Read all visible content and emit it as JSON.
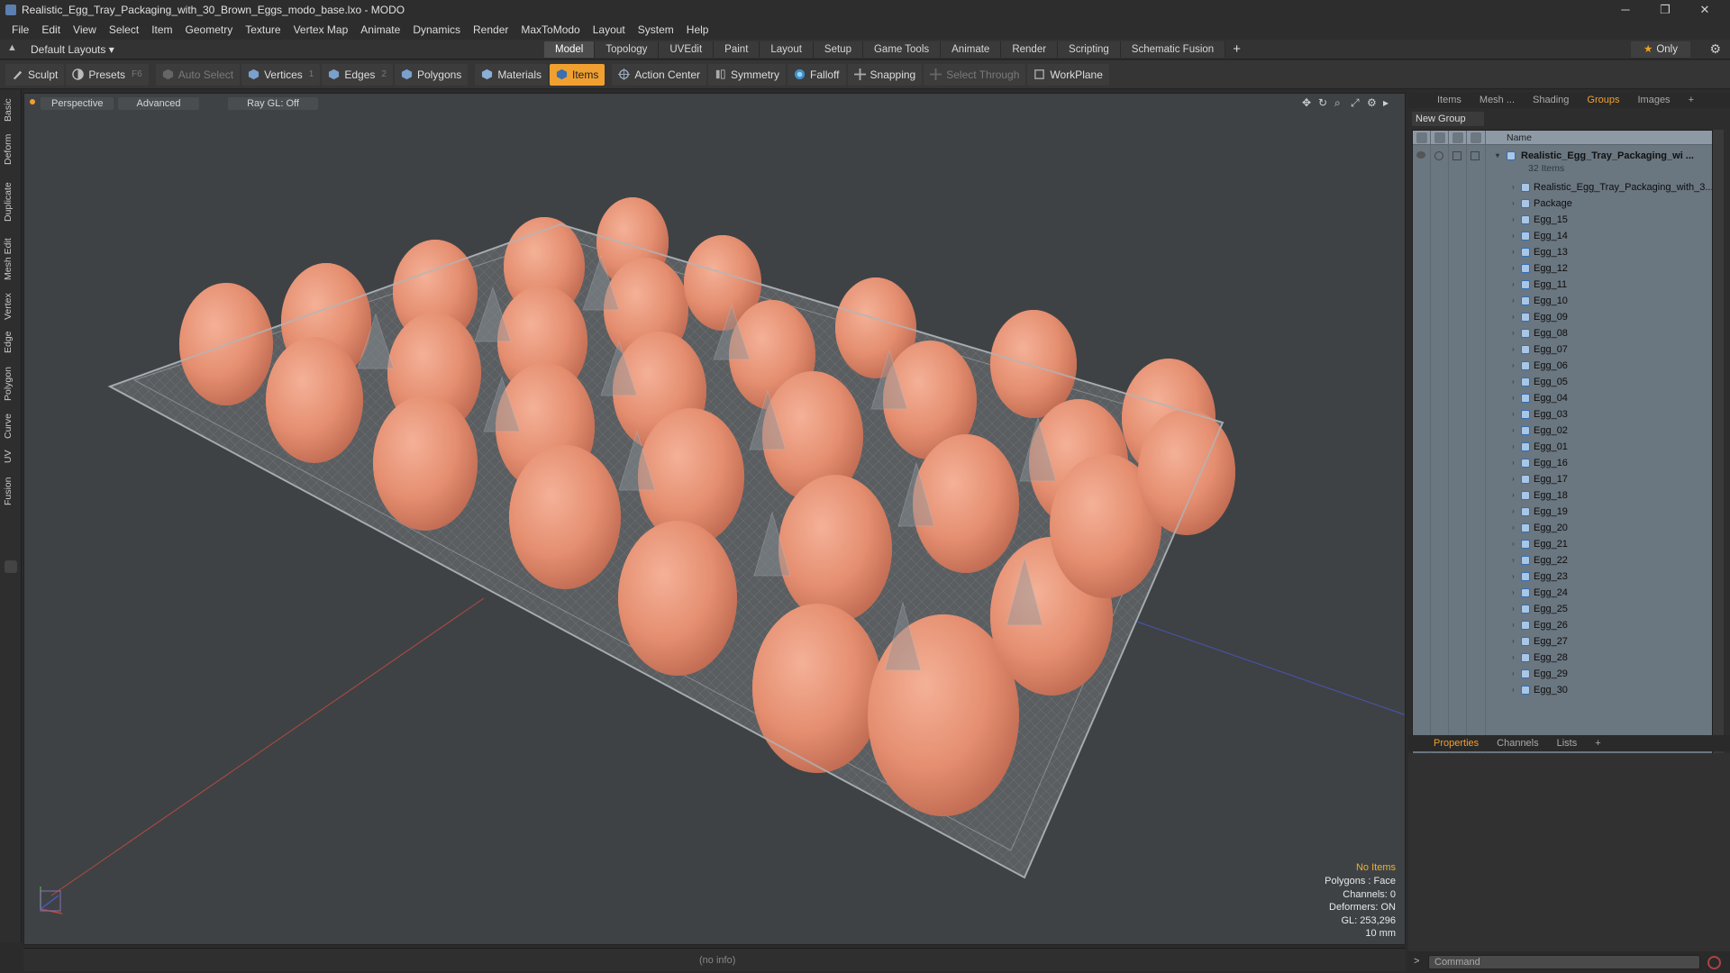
{
  "window": {
    "title": "Realistic_Egg_Tray_Packaging_with_30_Brown_Eggs_modo_base.lxo - MODO",
    "minimize": "─",
    "restore": "❐",
    "close": "✕"
  },
  "menu": [
    "File",
    "Edit",
    "View",
    "Select",
    "Item",
    "Geometry",
    "Texture",
    "Vertex Map",
    "Animate",
    "Dynamics",
    "Render",
    "MaxToModo",
    "Layout",
    "System",
    "Help"
  ],
  "layout": {
    "preset": "Default Layouts ▾",
    "tabs": [
      "Model",
      "Topology",
      "UVEdit",
      "Paint",
      "Layout",
      "Setup",
      "Game Tools",
      "Animate",
      "Render",
      "Scripting",
      "Schematic Fusion"
    ],
    "active_tab": "Model",
    "add": "+",
    "only_label": "Only",
    "star": "★"
  },
  "toolbar": {
    "sculpt": "Sculpt",
    "presets": "Presets",
    "presets_key": "F6",
    "auto_select": "Auto Select",
    "vertices": "Vertices",
    "vertices_key": "1",
    "edges": "Edges",
    "edges_key": "2",
    "polygons": "Polygons",
    "materials": "Materials",
    "items": "Items",
    "action_center": "Action Center",
    "symmetry": "Symmetry",
    "falloff": "Falloff",
    "snapping": "Snapping",
    "select_through": "Select Through",
    "workplane": "WorkPlane"
  },
  "left_tabs": [
    "Basic",
    "Deform",
    "Duplicate",
    "Mesh Edit",
    "Vertex",
    "Edge",
    "Polygon",
    "Curve",
    "UV",
    "Fusion"
  ],
  "viewport": {
    "view": "Perspective",
    "mode": "Advanced",
    "raygl": "Ray GL: Off",
    "info": {
      "selection": "No Items",
      "polygons": "Polygons : Face",
      "channels": "Channels: 0",
      "deformers": "Deformers: ON",
      "gl": "GL: 253,296",
      "unit": "10 mm"
    }
  },
  "status": {
    "text": "(no info)"
  },
  "right_panel": {
    "tabs": [
      "Items",
      "Mesh ...",
      "Shading",
      "Groups",
      "Images"
    ],
    "active_tab": "Groups",
    "new_group": "New Group",
    "column_name": "Name",
    "root": "Realistic_Egg_Tray_Packaging_wi ...",
    "root_count": "32 Items",
    "children": [
      "Realistic_Egg_Tray_Packaging_with_3...",
      "Package",
      "Egg_15",
      "Egg_14",
      "Egg_13",
      "Egg_12",
      "Egg_11",
      "Egg_10",
      "Egg_09",
      "Egg_08",
      "Egg_07",
      "Egg_06",
      "Egg_05",
      "Egg_04",
      "Egg_03",
      "Egg_02",
      "Egg_01",
      "Egg_16",
      "Egg_17",
      "Egg_18",
      "Egg_19",
      "Egg_20",
      "Egg_21",
      "Egg_22",
      "Egg_23",
      "Egg_24",
      "Egg_25",
      "Egg_26",
      "Egg_27",
      "Egg_28",
      "Egg_29",
      "Egg_30"
    ],
    "bottom_tabs": [
      "Properties",
      "Channels",
      "Lists"
    ],
    "bottom_active": "Properties",
    "command_placeholder": "Command",
    "prompt": ">"
  },
  "colors": {
    "accent": "#f0a030",
    "egg": "#e8957a",
    "viewport_bg": "#3e4245"
  }
}
